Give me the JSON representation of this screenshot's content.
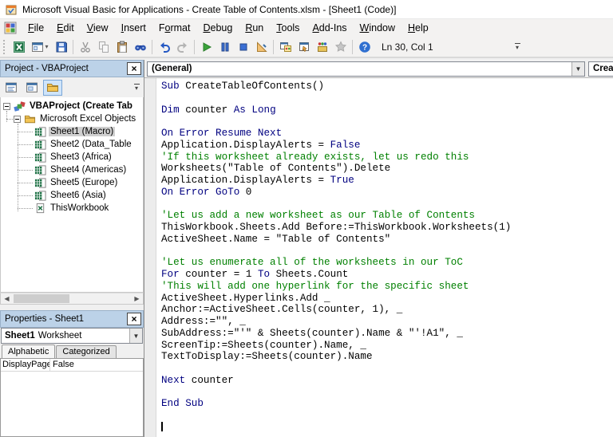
{
  "title_bar": {
    "title": "Microsoft Visual Basic for Applications - Create Table of Contents.xlsm - [Sheet1 (Code)]"
  },
  "menu_bar": {
    "items": [
      {
        "pre": "",
        "u": "F",
        "rest": "ile"
      },
      {
        "pre": "",
        "u": "E",
        "rest": "dit"
      },
      {
        "pre": "",
        "u": "V",
        "rest": "iew"
      },
      {
        "pre": "",
        "u": "I",
        "rest": "nsert"
      },
      {
        "pre": "F",
        "u": "o",
        "rest": "rmat"
      },
      {
        "pre": "",
        "u": "D",
        "rest": "ebug"
      },
      {
        "pre": "",
        "u": "R",
        "rest": "un"
      },
      {
        "pre": "",
        "u": "T",
        "rest": "ools"
      },
      {
        "pre": "",
        "u": "A",
        "rest": "dd-Ins"
      },
      {
        "pre": "",
        "u": "W",
        "rest": "indow"
      },
      {
        "pre": "",
        "u": "H",
        "rest": "elp"
      }
    ]
  },
  "toolbar": {
    "position_indicator": "Ln 30, Col 1",
    "buttons": [
      {
        "name": "view-microsoft-excel-button",
        "icon": "excel"
      },
      {
        "name": "insert-userform-button",
        "icon": "userform",
        "dropdown": true
      },
      {
        "name": "save-button",
        "icon": "save"
      },
      {
        "sep": true
      },
      {
        "name": "cut-button",
        "icon": "cut",
        "disabled": true
      },
      {
        "name": "copy-button",
        "icon": "copy",
        "disabled": true
      },
      {
        "name": "paste-button",
        "icon": "paste"
      },
      {
        "name": "find-button",
        "icon": "find"
      },
      {
        "sep": true
      },
      {
        "name": "undo-button",
        "icon": "undo"
      },
      {
        "name": "redo-button",
        "icon": "redo",
        "disabled": true
      },
      {
        "sep": true
      },
      {
        "name": "run-button",
        "icon": "run"
      },
      {
        "name": "break-button",
        "icon": "break"
      },
      {
        "name": "reset-button",
        "icon": "reset"
      },
      {
        "name": "design-mode-button",
        "icon": "design"
      },
      {
        "sep": true
      },
      {
        "name": "project-explorer-button",
        "icon": "projexp"
      },
      {
        "name": "properties-window-button",
        "icon": "propwin"
      },
      {
        "name": "object-browser-button",
        "icon": "objbrowser"
      },
      {
        "name": "toolbox-button",
        "icon": "toolbox",
        "disabled": true
      },
      {
        "sep": true
      },
      {
        "name": "help-button",
        "icon": "help"
      }
    ]
  },
  "project_panel": {
    "title": "Project - VBAProject",
    "toolbar": [
      {
        "name": "view-code-button",
        "icon": "viewcode"
      },
      {
        "name": "view-object-button",
        "icon": "viewobject"
      },
      {
        "name": "toggle-folders-button",
        "icon": "folder",
        "active": true
      }
    ],
    "tree": {
      "root": {
        "label": "VBAProject (Create Tab",
        "icon": "project"
      },
      "folder": {
        "label": "Microsoft Excel Objects",
        "icon": "folder"
      },
      "items": [
        {
          "label": "Sheet1 (Macro)",
          "icon": "sheet",
          "selected": true
        },
        {
          "label": "Sheet2 (Data_Table",
          "icon": "sheet"
        },
        {
          "label": "Sheet3 (Africa)",
          "icon": "sheet"
        },
        {
          "label": "Sheet4 (Americas)",
          "icon": "sheet"
        },
        {
          "label": "Sheet5 (Europe)",
          "icon": "sheet"
        },
        {
          "label": "Sheet6 (Asia)",
          "icon": "sheet"
        },
        {
          "label": "ThisWorkbook",
          "icon": "workbook"
        }
      ]
    }
  },
  "properties_panel": {
    "title": "Properties - Sheet1",
    "object_selector": {
      "name": "Sheet1",
      "type": "Worksheet"
    },
    "tabs": [
      {
        "label": "Alphabetic",
        "active": true
      },
      {
        "label": "Categorized",
        "active": false
      }
    ],
    "rows": [
      {
        "name": "DisplayPageBreaks",
        "value": "False"
      }
    ]
  },
  "code_window": {
    "object_dropdown": "(General)",
    "procedure_dropdown": "CreateTableOfContents",
    "lines": [
      {
        "s": [
          [
            "k",
            "Sub"
          ],
          [
            "n",
            " CreateTableOfContents()"
          ]
        ]
      },
      {
        "s": []
      },
      {
        "s": [
          [
            "k",
            "Dim"
          ],
          [
            "n",
            " counter "
          ],
          [
            "k",
            "As"
          ],
          [
            "n",
            " "
          ],
          [
            "k",
            "Long"
          ]
        ]
      },
      {
        "s": []
      },
      {
        "s": [
          [
            "k",
            "On Error Resume Next"
          ]
        ]
      },
      {
        "s": [
          [
            "n",
            "Application.DisplayAlerts = "
          ],
          [
            "k",
            "False"
          ]
        ]
      },
      {
        "s": [
          [
            "c",
            "'If this worksheet already exists, let us redo this"
          ]
        ]
      },
      {
        "s": [
          [
            "n",
            "Worksheets(\"Table of Contents\").Delete"
          ]
        ]
      },
      {
        "s": [
          [
            "n",
            "Application.DisplayAlerts = "
          ],
          [
            "k",
            "True"
          ]
        ]
      },
      {
        "s": [
          [
            "k",
            "On Error GoTo"
          ],
          [
            "n",
            " 0"
          ]
        ]
      },
      {
        "s": []
      },
      {
        "s": [
          [
            "c",
            "'Let us add a new worksheet as our Table of Contents"
          ]
        ]
      },
      {
        "s": [
          [
            "n",
            "ThisWorkbook.Sheets.Add Before:=ThisWorkbook.Worksheets(1)"
          ]
        ]
      },
      {
        "s": [
          [
            "n",
            "ActiveSheet.Name = \"Table of Contents\""
          ]
        ]
      },
      {
        "s": []
      },
      {
        "s": [
          [
            "c",
            "'Let us enumerate all of the worksheets in our ToC"
          ]
        ]
      },
      {
        "s": [
          [
            "k",
            "For"
          ],
          [
            "n",
            " counter = 1 "
          ],
          [
            "k",
            "To"
          ],
          [
            "n",
            " Sheets.Count"
          ]
        ]
      },
      {
        "s": [
          [
            "c",
            "'This will add one hyperlink for the specific sheet"
          ]
        ]
      },
      {
        "s": [
          [
            "n",
            "ActiveSheet.Hyperlinks.Add _"
          ]
        ]
      },
      {
        "s": [
          [
            "n",
            "Anchor:=ActiveSheet.Cells(counter, 1), _"
          ]
        ]
      },
      {
        "s": [
          [
            "n",
            "Address:=\"\", _"
          ]
        ]
      },
      {
        "s": [
          [
            "n",
            "SubAddress:=\"'\" & Sheets(counter).Name & \"'!A1\", _"
          ]
        ]
      },
      {
        "s": [
          [
            "n",
            "ScreenTip:=Sheets(counter).Name, _"
          ]
        ]
      },
      {
        "s": [
          [
            "n",
            "TextToDisplay:=Sheets(counter).Name"
          ]
        ]
      },
      {
        "s": []
      },
      {
        "s": [
          [
            "k",
            "Next"
          ],
          [
            "n",
            " counter"
          ]
        ]
      },
      {
        "s": []
      },
      {
        "s": [
          [
            "k",
            "End Sub"
          ]
        ]
      },
      {
        "s": []
      },
      {
        "s": [],
        "caret": true
      }
    ]
  },
  "colors": {
    "keyword": "#000080",
    "comment": "#008000",
    "panel_header": "#bcd2e8",
    "selection": "#cfcfcf"
  }
}
